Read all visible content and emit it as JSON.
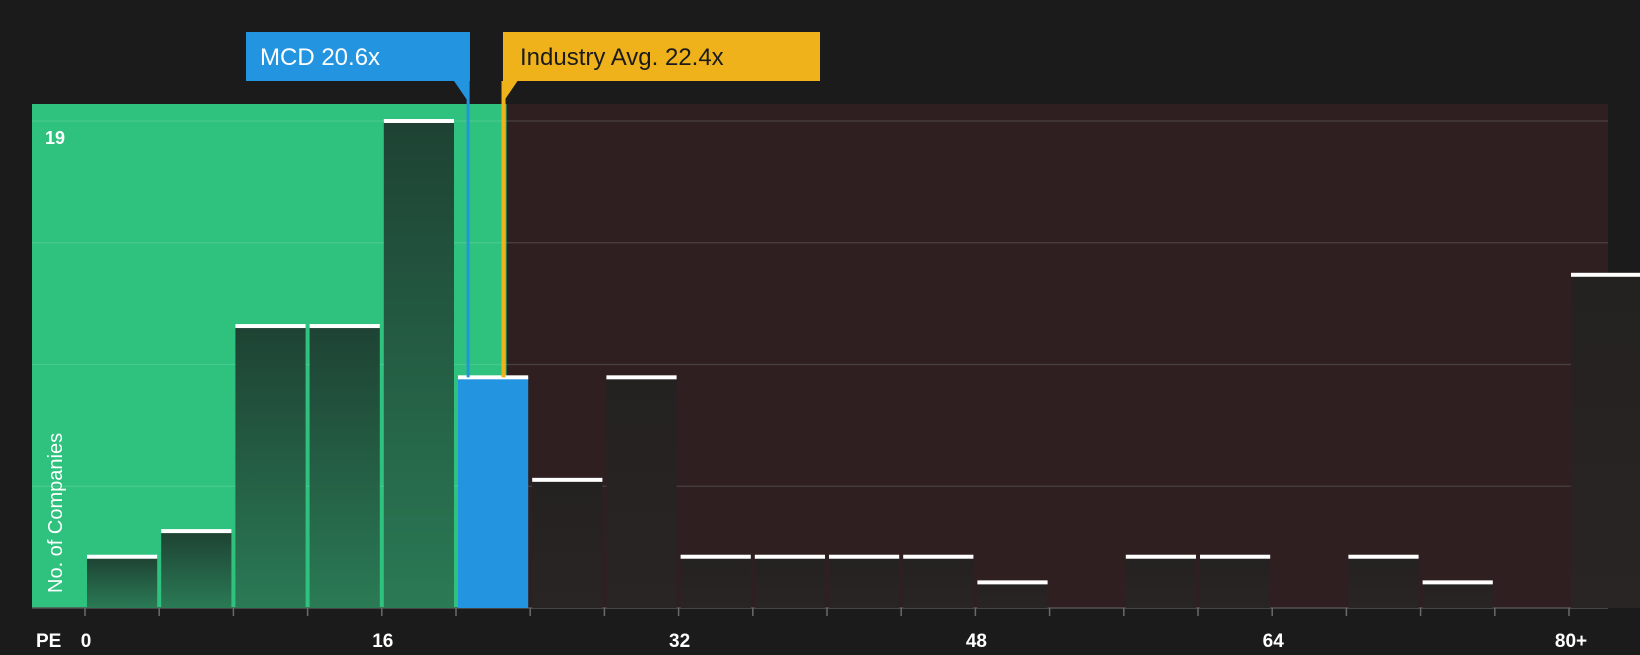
{
  "chart_data": {
    "type": "bar",
    "x_axis_label": "PE",
    "y_axis_label": "No. of Companies",
    "y_max_label": "19",
    "ylim": [
      0,
      19
    ],
    "x_ticks": [
      "0",
      "16",
      "32",
      "48",
      "64",
      "80+"
    ],
    "bin_width": 4,
    "bins": [
      {
        "start": 0,
        "end": 4,
        "count": 2
      },
      {
        "start": 4,
        "end": 8,
        "count": 3
      },
      {
        "start": 8,
        "end": 12,
        "count": 11
      },
      {
        "start": 12,
        "end": 16,
        "count": 11
      },
      {
        "start": 16,
        "end": 20,
        "count": 19
      },
      {
        "start": 20,
        "end": 24,
        "count": 9,
        "highlight": true
      },
      {
        "start": 24,
        "end": 28,
        "count": 5
      },
      {
        "start": 28,
        "end": 32,
        "count": 9
      },
      {
        "start": 32,
        "end": 36,
        "count": 2
      },
      {
        "start": 36,
        "end": 40,
        "count": 2
      },
      {
        "start": 40,
        "end": 44,
        "count": 2
      },
      {
        "start": 44,
        "end": 48,
        "count": 2
      },
      {
        "start": 48,
        "end": 52,
        "count": 1
      },
      {
        "start": 52,
        "end": 56,
        "count": 0
      },
      {
        "start": 56,
        "end": 60,
        "count": 2
      },
      {
        "start": 60,
        "end": 64,
        "count": 2
      },
      {
        "start": 64,
        "end": 68,
        "count": 0
      },
      {
        "start": 68,
        "end": 72,
        "count": 2
      },
      {
        "start": 72,
        "end": 76,
        "count": 1
      },
      {
        "start": 76,
        "end": 80,
        "count": 0
      },
      {
        "start": 80,
        "end": 84,
        "count": 13
      }
    ],
    "markers": [
      {
        "name": "company",
        "label": "MCD 20.6x",
        "value": 20.6,
        "color": "#2394e0",
        "text_color": "#ffffff"
      },
      {
        "name": "industry",
        "label": "Industry Avg. 22.4x",
        "value": 22.4,
        "color": "#f0b21b",
        "text_color": "#1b1b1b"
      }
    ],
    "colors": {
      "background": "#1b1b1b",
      "undervalued_zone": "#2ec27e",
      "overvalued_zone": "#2f1f20",
      "bar_green_zone": "#1f4a35",
      "bar_dark": "#262222",
      "bar_highlight": "#2394e0",
      "bar_cap": "#ffffff",
      "grid": "#4a4040",
      "axis_text": "#ffffff"
    }
  }
}
